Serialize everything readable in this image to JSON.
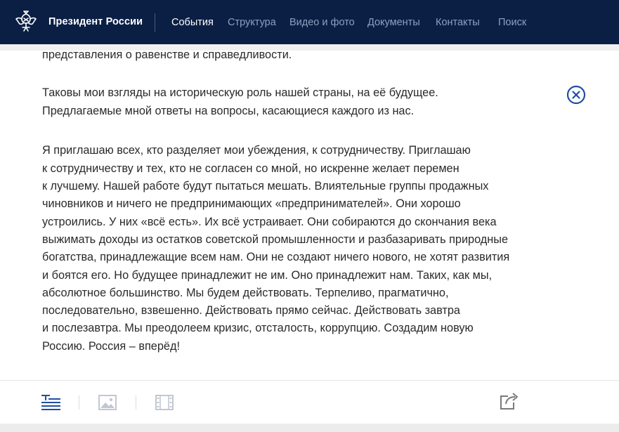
{
  "header": {
    "brand": "Президент России",
    "nav": [
      {
        "label": "События",
        "active": true
      },
      {
        "label": "Структура",
        "active": false
      },
      {
        "label": "Видео и фото",
        "active": false
      },
      {
        "label": "Документы",
        "active": false
      },
      {
        "label": "Контакты",
        "active": false
      },
      {
        "label": "Поиск",
        "active": false
      }
    ]
  },
  "article": {
    "lines": [
      "представления о равенстве и справедливости.",
      "Таковы мои взгляды на историческую роль нашей страны, на её будущее.",
      "Предлагаемые мной ответы на вопросы, касающиеся каждого из нас.",
      "Я приглашаю всех, кто разделяет мои убеждения, к сотрудничеству. Приглашаю",
      "к сотрудничеству и тех, кто не согласен со мной, но искренне желает перемен",
      "к лучшему. Нашей работе будут пытаться мешать. Влиятельные группы продажных",
      "чиновников и ничего не предпринимающих «предпринимателей». Они хорошо",
      "устроились. У них «всё есть». Их всё устраивает. Они собираются до скончания века",
      "выжимать доходы из остатков советской промышленности и разбазаривать природные",
      "богатства, принадлежащие всем нам. Они не создают ничего нового, не хотят развития",
      "и боятся его. Но будущее принадлежит не им. Оно принадлежит нам. Таких, как мы,",
      "абсолютное большинство. Мы будем действовать. Терпеливо, прагматично,",
      "последовательно, взвешенно. Действовать прямо сейчас. Действовать завтра",
      "и послезавтра. Мы преодолеем кризис, отсталость, коррупцию. Создадим новую",
      "Россию. Россия – вперёд!"
    ]
  },
  "icons": {
    "emblem": "emblem-icon",
    "close": "close-icon",
    "text_view": "text-view-icon",
    "photo": "photo-icon",
    "video": "video-icon",
    "share": "share-icon"
  },
  "colors": {
    "header_bg": "#0b1f45",
    "accent": "#1f4fa0",
    "text": "#2a2a2a"
  }
}
